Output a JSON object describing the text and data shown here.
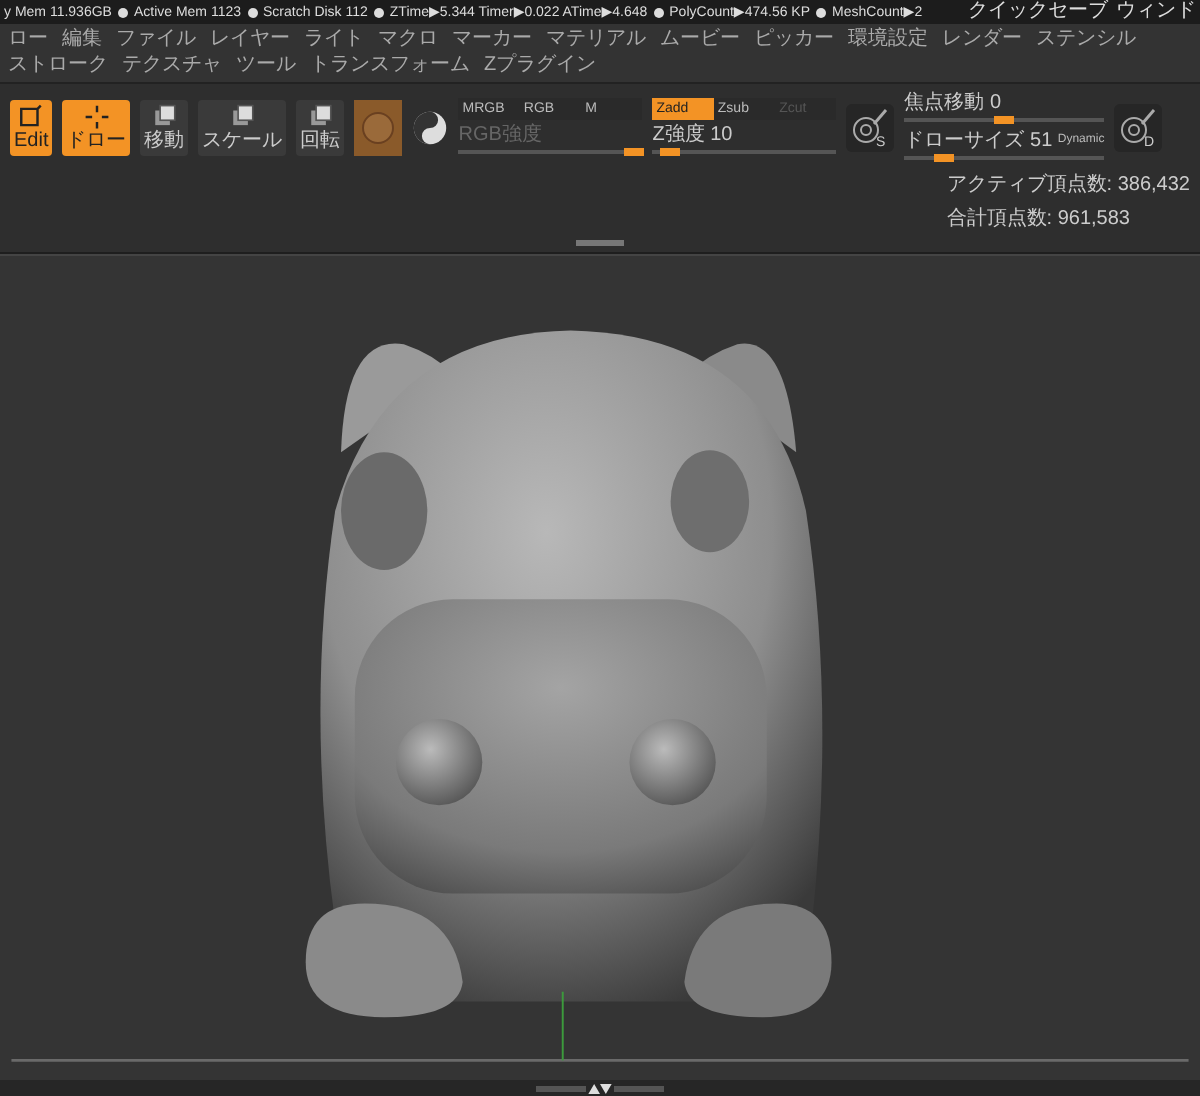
{
  "status_bar": {
    "items": [
      "y Mem 11.936GB",
      "Active Mem 1123",
      "Scratch Disk 112",
      "ZTime▶5.344 Timer▶0.022 ATime▶4.648",
      "PolyCount▶474.56 KP",
      "MeshCount▶2"
    ],
    "right": [
      "クイックセーブ",
      "ウィンド"
    ]
  },
  "menu": [
    "ロー",
    "編集",
    "ファイル",
    "レイヤー",
    "ライト",
    "マクロ",
    "マーカー",
    "マテリアル",
    "ムービー",
    "ピッカー",
    "環境設定",
    "レンダー",
    "ステンシル",
    "ストローク",
    "テクスチャ",
    "ツール",
    "トランスフォーム",
    "Zプラグイン"
  ],
  "toolbar": {
    "tools": [
      {
        "label": "Edit",
        "kind": "edit",
        "selected": true
      },
      {
        "label": "ドロー",
        "kind": "draw",
        "selected": true
      },
      {
        "label": "移動",
        "kind": "move",
        "selected": false
      },
      {
        "label": "スケール",
        "kind": "scale",
        "selected": false
      },
      {
        "label": "回転",
        "kind": "rotate",
        "selected": false
      }
    ],
    "channels": [
      {
        "label": "MRGB",
        "selected": false
      },
      {
        "label": "RGB",
        "selected": false
      },
      {
        "label": "M",
        "selected": false
      }
    ],
    "rgb_intensity": {
      "label": "RGB強度",
      "disabled": true,
      "level": 0.95
    },
    "z_modes": [
      {
        "label": "Zadd",
        "selected": true,
        "disabled": false
      },
      {
        "label": "Zsub",
        "selected": false,
        "disabled": false
      },
      {
        "label": "Zcut",
        "selected": false,
        "disabled": true
      }
    ],
    "z_intensity": {
      "label": "Z強度 10",
      "level": 0.1
    },
    "focal_shift": {
      "label": "焦点移動 0",
      "level": 0.5
    },
    "draw_size": {
      "label": "ドローサイズ 51",
      "level": 0.2,
      "badge": "Dynamic"
    },
    "brush_letters": [
      "S",
      "D"
    ],
    "stats": [
      "アクティブ頂点数: 386,432",
      "合計頂点数: 961,583"
    ]
  }
}
